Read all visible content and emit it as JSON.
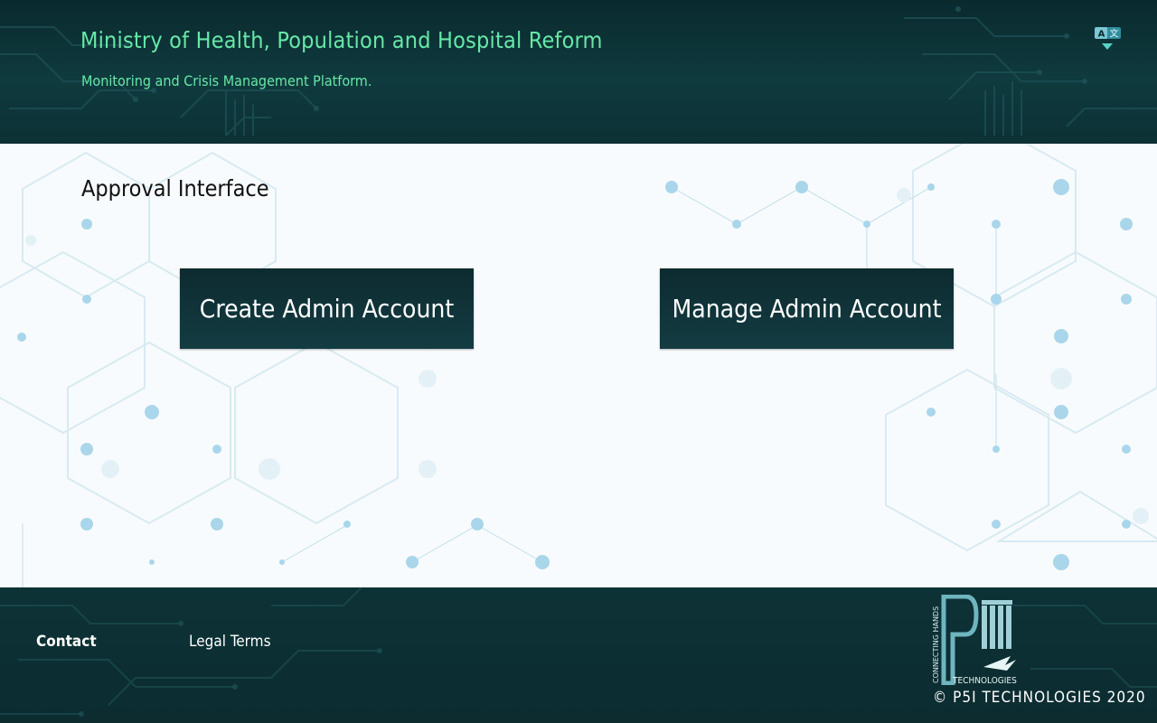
{
  "header": {
    "title": "Ministry of Health, Population and Hospital Reform",
    "subtitle": "Monitoring and Crisis Management Platform.",
    "language_icon": "translate-icon"
  },
  "main": {
    "page_title": "Approval Interface",
    "create_button": "Create Admin Account",
    "manage_button": "Manage Admin Account"
  },
  "footer": {
    "contact": "Contact",
    "legal": "Legal Terms",
    "logo_tagline": "CONNECTING HANDS",
    "logo_wordmark": "TECHNOLOGIES",
    "copyright": "© P5I TECHNOLOGIES 2020"
  },
  "colors": {
    "header_bg": "#0f3a3e",
    "title_green": "#67e8a7",
    "button_bg": "#133c42",
    "footer_bg": "#0d3236",
    "hex_blue": "#a8d8ea"
  }
}
